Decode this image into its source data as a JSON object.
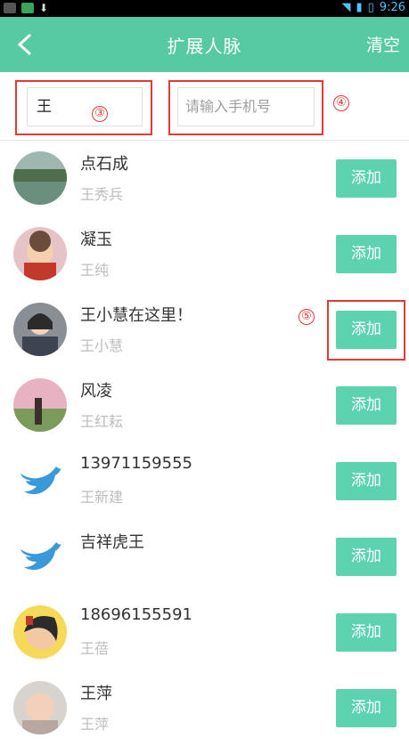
{
  "status_bar": {
    "time": "9:26"
  },
  "header": {
    "title": "扩展人脉",
    "clear_label": "清空"
  },
  "search": {
    "name_value": "王",
    "phone_placeholder": "请输入手机号",
    "marker_name": "③",
    "marker_phone": "④"
  },
  "marker_add": "⑤",
  "contacts": [
    {
      "name": "点石成",
      "sub": "王秀兵",
      "button": "添加",
      "avatar": "landscape"
    },
    {
      "name": "凝玉",
      "sub": "王纯",
      "button": "添加",
      "avatar": "baby"
    },
    {
      "name": "王小慧在这里！",
      "sub": "王小慧",
      "button": "添加",
      "avatar": "portrait"
    },
    {
      "name": "风凌",
      "sub": "王红耘",
      "button": "添加",
      "avatar": "trees"
    },
    {
      "name": "13971159555",
      "sub": "王新建",
      "button": "添加",
      "avatar": "twitter-bird"
    },
    {
      "name": "吉祥虎王",
      "sub": "",
      "button": "添加",
      "avatar": "twitter-bird"
    },
    {
      "name": "18696155591",
      "sub": "王蓓",
      "button": "添加",
      "avatar": "cartoon"
    },
    {
      "name": "王萍",
      "sub": "王萍",
      "button": "添加",
      "avatar": "child"
    }
  ],
  "colors": {
    "primary": "#57c9a3",
    "button": "#5cd2ae",
    "annotation": "#e53935"
  }
}
